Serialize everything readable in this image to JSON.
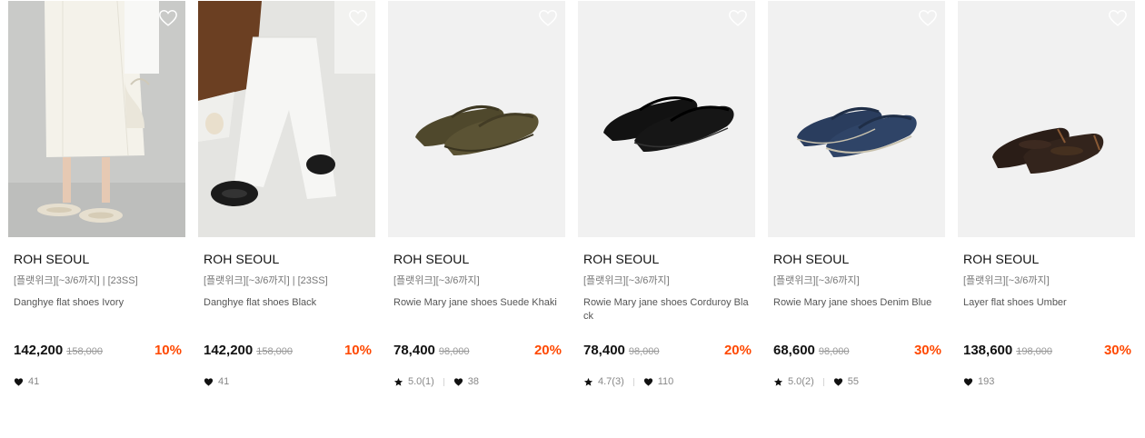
{
  "products": [
    {
      "brand": "ROH SEOUL",
      "promo": "[플랫위크][~3/6까지] | [23SS]",
      "name": "Danghye flat shoes Ivory",
      "price": "142,200",
      "original_price": "158,000",
      "discount": "10%",
      "rating": "",
      "likes": "41",
      "image": "model-ivory-flats-with-bag",
      "colors": {
        "shoe": "#e6dfcf",
        "bg": "#c7c8c6"
      }
    },
    {
      "brand": "ROH SEOUL",
      "promo": "[플랫위크][~3/6까지] | [23SS]",
      "name": "Danghye flat shoes Black",
      "price": "142,200",
      "original_price": "158,000",
      "discount": "10%",
      "rating": "",
      "likes": "41",
      "image": "model-black-flats-white-pants",
      "colors": {
        "shoe": "#1b1b1b",
        "bg": "#e6e6e3"
      }
    },
    {
      "brand": "ROH SEOUL",
      "promo": "[플랫위크][~3/6까지]",
      "name": "Rowie Mary jane shoes Suede Khaki",
      "price": "78,400",
      "original_price": "98,000",
      "discount": "20%",
      "rating": "5.0(1)",
      "likes": "38",
      "image": "khaki-suede-mary-jane-pair",
      "colors": {
        "shoe": "#5b5334",
        "bg": "#f1f1f1"
      }
    },
    {
      "brand": "ROH SEOUL",
      "promo": "[플랫위크][~3/6까지]",
      "name": "Rowie Mary jane shoes Corduroy Black",
      "price": "78,400",
      "original_price": "98,000",
      "discount": "20%",
      "rating": "4.7(3)",
      "likes": "110",
      "image": "black-corduroy-mary-jane-pair",
      "colors": {
        "shoe": "#111111",
        "bg": "#f1f1f1"
      }
    },
    {
      "brand": "ROH SEOUL",
      "promo": "[플랫위크][~3/6까지]",
      "name": "Rowie Mary jane shoes Denim Blue",
      "price": "68,600",
      "original_price": "98,000",
      "discount": "30%",
      "rating": "5.0(2)",
      "likes": "55",
      "image": "denim-blue-mary-jane-pair",
      "colors": {
        "shoe": "#2f4467",
        "bg": "#f1f1f1"
      }
    },
    {
      "brand": "ROH SEOUL",
      "promo": "[플랫위크][~3/6까지]",
      "name": "Layer flat shoes Umber",
      "price": "138,600",
      "original_price": "198,000",
      "discount": "30%",
      "rating": "",
      "likes": "193",
      "image": "umber-leather-flat-pair",
      "colors": {
        "shoe": "#2a1d17",
        "bg": "#f1f1f1"
      }
    }
  ],
  "icons": {
    "wishlist": "heart-outline-icon",
    "likes": "heart-icon",
    "rating": "star-icon"
  },
  "accent": {
    "discount": "#ff4800"
  }
}
